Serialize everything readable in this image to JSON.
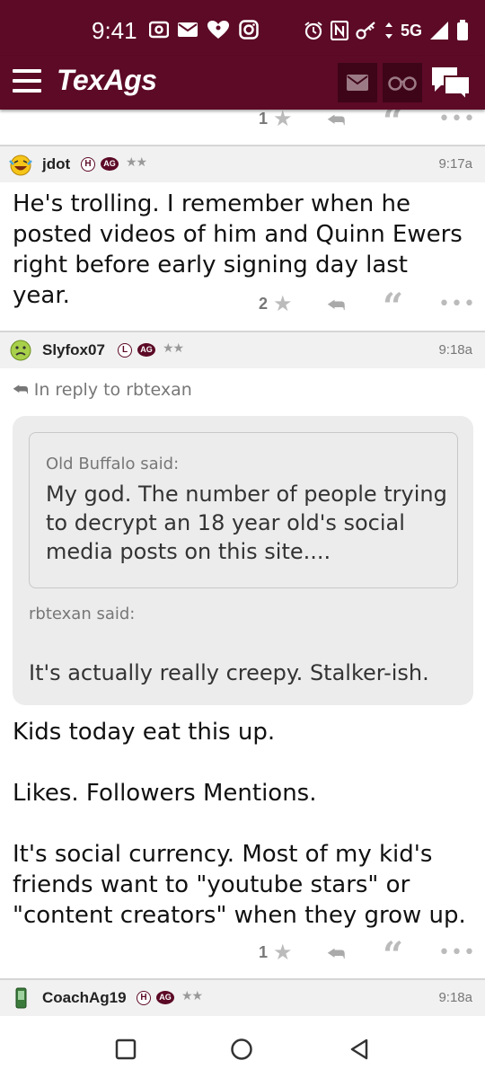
{
  "status_bar": {
    "time": "9:41",
    "network": "5G"
  },
  "app": {
    "logo": "TexAgs"
  },
  "posts_top_actions": {
    "likes": "1"
  },
  "posts": [
    {
      "username": "jdot",
      "badge_letter": "H",
      "badge_ag": "AG",
      "stars": "★★",
      "time": "9:17a",
      "body": "He's trolling. I remember when he posted videos of him and Quinn Ewers right before early signing day last year.",
      "likes": "2"
    },
    {
      "username": "Slyfox07",
      "badge_letter": "L",
      "badge_ag": "AG",
      "stars": "★★",
      "time": "9:18a",
      "in_reply_to": "In reply to rbtexan",
      "quote_nested_author": "Old Buffalo said:",
      "quote_nested_text": "My god. The number of people trying to decrypt an 18 year old's social media posts on this site....",
      "quote_author": "rbtexan said:",
      "quote_text": "It's actually really creepy. Stalker-ish.",
      "body_1": "Kids today eat this up.",
      "body_2": "Likes. Followers Mentions.",
      "body_3": "It's social currency. Most of my kid's friends want to \"youtube stars\" or \"content creators\" when they grow up.",
      "likes": "1"
    },
    {
      "username": "CoachAg19",
      "badge_letter": "H",
      "badge_ag": "AG",
      "stars": "★★",
      "time": "9:18a"
    }
  ],
  "colors": {
    "brand": "#5c0a26",
    "header_bg": "#f1f1f1",
    "quote_bg": "#ececec"
  }
}
